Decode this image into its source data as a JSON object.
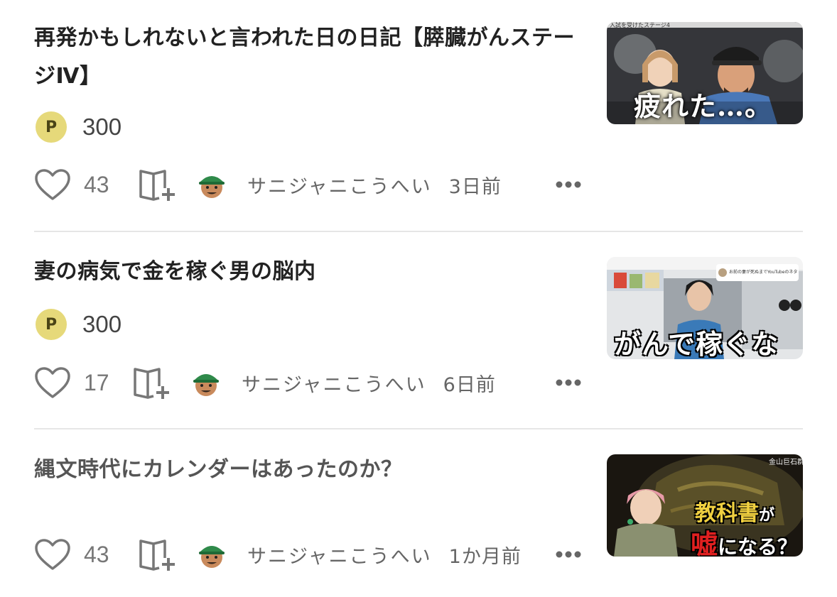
{
  "articles": [
    {
      "title": "再発かもしれないと言われた日の日記【膵臓がんステージⅣ】",
      "price_icon": "P",
      "price": "300",
      "likes": "43",
      "author": "サニジャニこうへい",
      "date": "3日前",
      "thumbnail_caption": "疲れた…。",
      "thumbnail_top_text": "入試を受けたステージ4"
    },
    {
      "title": "妻の病気で金を稼ぐ男の脳内",
      "price_icon": "P",
      "price": "300",
      "likes": "17",
      "author": "サニジャニこうへい",
      "date": "6日前",
      "thumbnail_caption": "がんで稼ぐな",
      "thumbnail_top_text": "お前の妻が死ぬまでYouTubeのネタだ"
    },
    {
      "title": "縄文時代にカレンダーはあったのか？",
      "likes": "43",
      "author": "サニジャニこうへい",
      "date": "1か月前",
      "thumbnail_caption_line1": "教科書",
      "thumbnail_caption_ga": "が",
      "thumbnail_caption_red": "嘘",
      "thumbnail_caption_line2": "になる？",
      "thumbnail_top_text": "金山巨石群"
    }
  ],
  "icons": {
    "like": "heart-outline-icon",
    "add_to_magazine": "magazine-add-icon",
    "more": "more-horizontal-icon",
    "paid": "point-coin-icon"
  },
  "colors": {
    "coin": "#e6d97a",
    "text_primary": "#222222",
    "text_secondary": "#666666",
    "divider": "#e6e6e6"
  }
}
